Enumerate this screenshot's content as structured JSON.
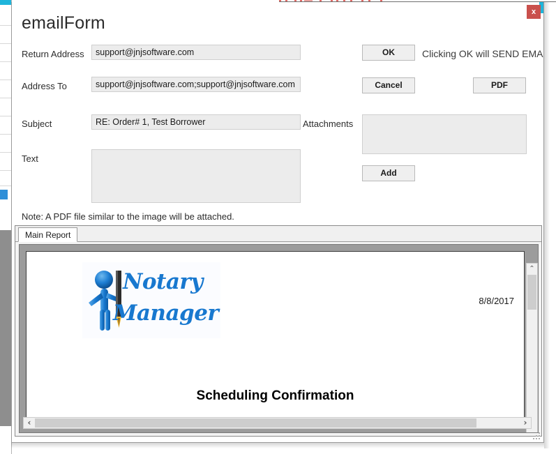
{
  "window": {
    "title": "emailForm",
    "close_label": "x"
  },
  "form": {
    "fields": [
      {
        "label": "Return Address",
        "value": "support@jnjsoftware.com",
        "placeholder": ""
      },
      {
        "label": "Address To",
        "value": "support@jnjsoftware.com;support@jnjsoftware.com",
        "placeholder": ""
      },
      {
        "label": "Subject",
        "value": "RE: Order# 1, Test Borrower",
        "placeholder": ""
      },
      {
        "label": "Text",
        "value": "",
        "placeholder": ""
      }
    ],
    "attachments_label": "Attachments",
    "attachments_value": "",
    "note": "Note: A PDF file similar to the image will be attached."
  },
  "buttons": {
    "ok": "OK",
    "cancel": "Cancel",
    "pdf": "PDF",
    "add": "Add"
  },
  "hints": {
    "ok_warning": "Clicking OK will SEND EMAIL"
  },
  "report": {
    "tab_label": "Main Report",
    "logo_line1": "Notary",
    "logo_line2": "Manager",
    "date": "8/8/2017",
    "heading": "Scheduling Confirmation"
  },
  "scrollbars": {
    "vertical": {
      "up": "⌃",
      "down": "⌄"
    },
    "horizontal": {
      "left": "‹",
      "right": "›"
    }
  },
  "colors": {
    "accent": "#1fb5db",
    "close_button": "#c9504c",
    "logo_blue": "#1878cf",
    "field_fill": "#ececec",
    "button_fill": "#efefef"
  }
}
